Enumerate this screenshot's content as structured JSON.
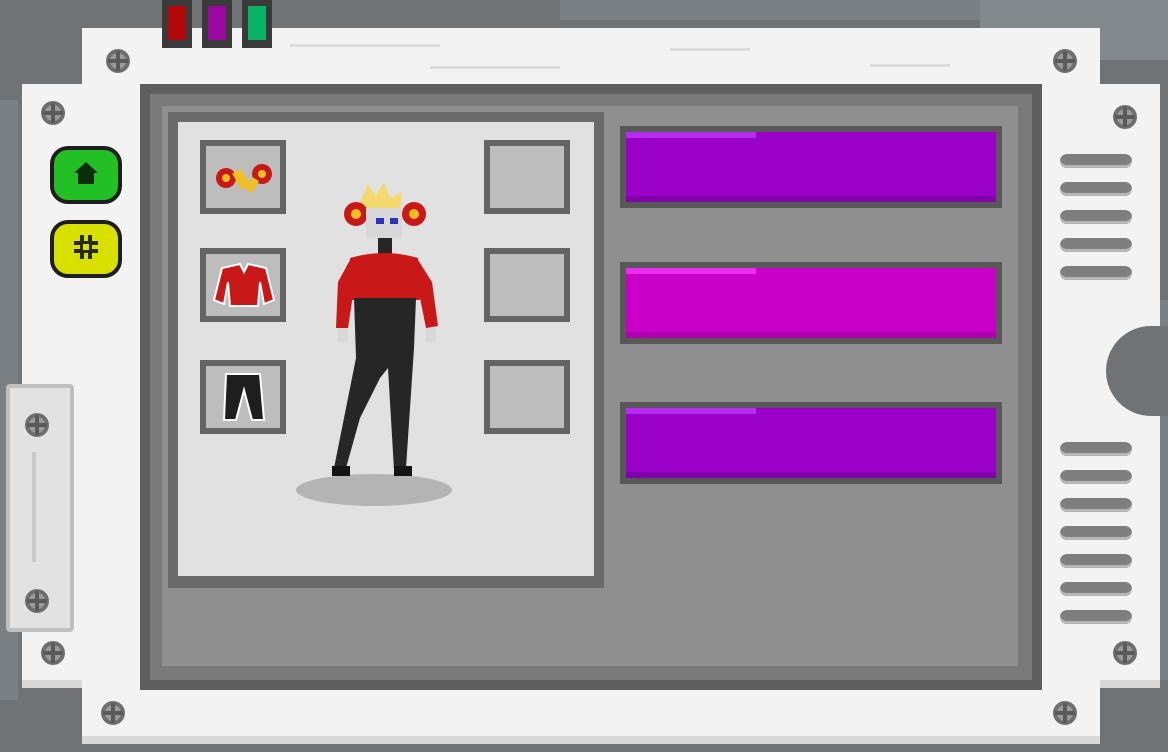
{
  "colors": {
    "frame": "#f3f3f3",
    "screen": "#8f8f8f",
    "character_panel": "#e1e1e1",
    "home_button": "#22c024",
    "settings_button": "#d8e000",
    "bar_purple": "#9a00c8",
    "bar_magenta": "#c800c8",
    "tab_red": "#b00808",
    "tab_purple": "#9a0aa0",
    "tab_green": "#06b463"
  },
  "color_tabs": [
    {
      "name": "red-tab",
      "color": "#b00808"
    },
    {
      "name": "purple-tab",
      "color": "#9a0aa0"
    },
    {
      "name": "green-tab",
      "color": "#06b463"
    }
  ],
  "nav": [
    {
      "name": "home-button",
      "icon": "home-icon",
      "color": "#22c024"
    },
    {
      "name": "settings-button",
      "icon": "gear-icon",
      "color": "#d8e000"
    }
  ],
  "equipment_slots": {
    "left": [
      "hair-accessory-icon",
      "red-jacket-icon",
      "black-pants-icon"
    ],
    "right": [
      "empty",
      "empty",
      "empty"
    ]
  },
  "stat_bars": [
    {
      "name": "stat-bar-1",
      "color": "#9a00c8"
    },
    {
      "name": "stat-bar-2",
      "color": "#c800c8"
    },
    {
      "name": "stat-bar-3",
      "color": "#9a00c8"
    }
  ],
  "vent_groups": [
    5,
    7
  ]
}
